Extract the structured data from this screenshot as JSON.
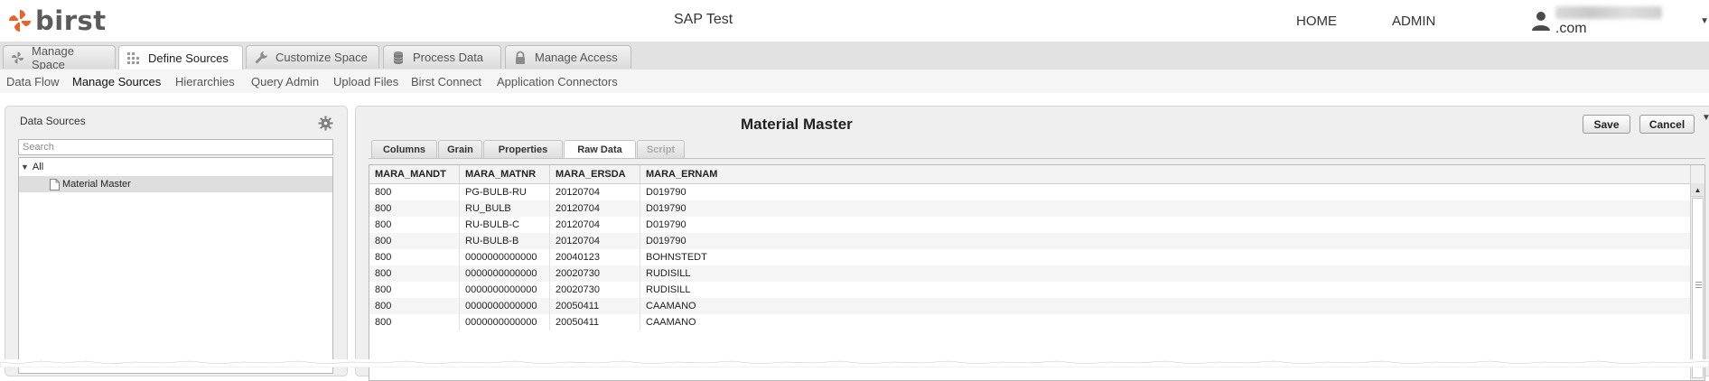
{
  "header": {
    "logo_text": "birst",
    "space_title": "SAP Test",
    "nav": {
      "home": "HOME",
      "admin": "ADMIN"
    },
    "user": {
      "email_domain": ".com",
      "icon": "user-icon"
    }
  },
  "main_tabs": [
    {
      "label": "Manage Space",
      "icon": "pinwheel-icon",
      "active": false
    },
    {
      "label": "Define Sources",
      "icon": "grid-icon",
      "active": true
    },
    {
      "label": "Customize Space",
      "icon": "wrench-icon",
      "active": false
    },
    {
      "label": "Process Data",
      "icon": "database-icon",
      "active": false
    },
    {
      "label": "Manage Access",
      "icon": "lock-icon",
      "active": false
    }
  ],
  "sub_nav": [
    {
      "label": "Data Flow",
      "active": false
    },
    {
      "label": "Manage Sources",
      "active": true
    },
    {
      "label": "Hierarchies",
      "active": false
    },
    {
      "label": "Query Admin",
      "active": false
    },
    {
      "label": "Upload Files",
      "active": false
    },
    {
      "label": "Birst Connect",
      "active": false
    },
    {
      "label": "Application Connectors",
      "active": false
    }
  ],
  "left_panel": {
    "title": "Data Sources",
    "search_placeholder": "Search",
    "tree_root": "All",
    "tree_items": [
      {
        "label": "Material Master",
        "selected": true
      }
    ]
  },
  "right_panel": {
    "title": "Material Master",
    "buttons": {
      "save": "Save",
      "cancel": "Cancel"
    },
    "tabs": [
      {
        "label": "Columns",
        "active": false,
        "disabled": false
      },
      {
        "label": "Grain",
        "active": false,
        "disabled": false
      },
      {
        "label": "Properties",
        "active": false,
        "disabled": false
      },
      {
        "label": "Raw Data",
        "active": true,
        "disabled": false
      },
      {
        "label": "Script",
        "active": false,
        "disabled": true
      }
    ],
    "table": {
      "columns": [
        "MARA_MANDT",
        "MARA_MATNR",
        "MARA_ERSDA",
        "MARA_ERNAM"
      ],
      "rows": [
        [
          "800",
          "PG-BULB-RU",
          "20120704",
          "D019790"
        ],
        [
          "800",
          "RU_BULB",
          "20120704",
          "D019790"
        ],
        [
          "800",
          "RU-BULB-C",
          "20120704",
          "D019790"
        ],
        [
          "800",
          "RU-BULB-B",
          "20120704",
          "D019790"
        ],
        [
          "800",
          "0000000000000",
          "20040123",
          "BOHNSTEDT"
        ],
        [
          "800",
          "0000000000000",
          "20020730",
          "RUDISILL"
        ],
        [
          "800",
          "0000000000000",
          "20020730",
          "RUDISILL"
        ],
        [
          "800",
          "0000000000000",
          "20050411",
          "CAAMANO"
        ],
        [
          "800",
          "0000000000000",
          "20050411",
          "CAAMANO"
        ]
      ]
    }
  },
  "colors": {
    "logo_accent": "#e8622a",
    "header_bg": "#ffffff",
    "tabbar_bg": "#e2e2e2",
    "panel_bg": "#efefef"
  }
}
